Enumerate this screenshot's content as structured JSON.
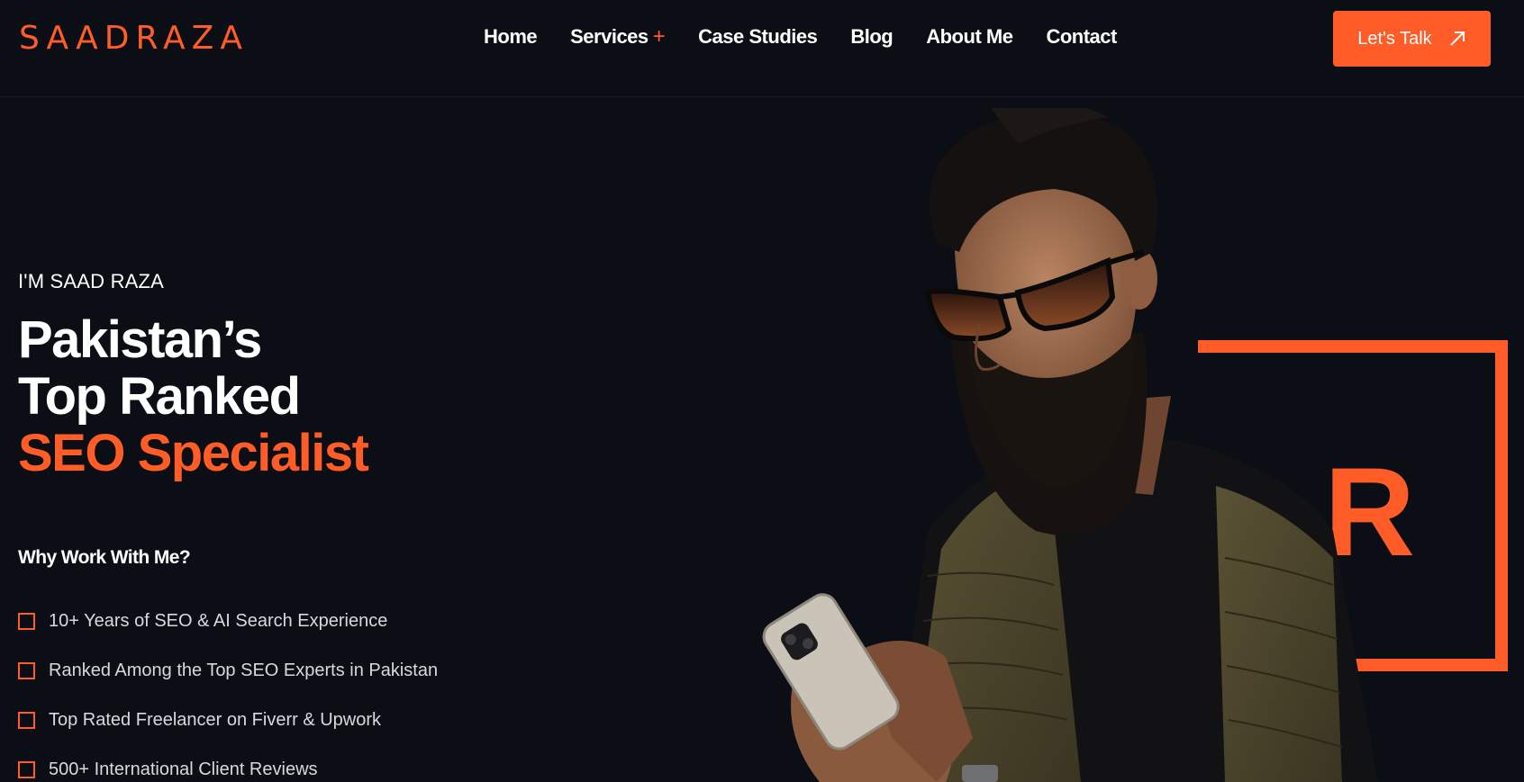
{
  "brand": {
    "logo_text": "SAADRAZA",
    "accent_color": "#ff5c27",
    "bg_color": "#0b0e15"
  },
  "nav": {
    "items": [
      {
        "label": "Home"
      },
      {
        "label": "Services",
        "has_submenu": true,
        "submenu_icon": "+"
      },
      {
        "label": "Case Studies"
      },
      {
        "label": "Blog"
      },
      {
        "label": "About Me"
      },
      {
        "label": "Contact"
      }
    ]
  },
  "cta": {
    "label": "Let's Talk",
    "icon": "arrow-up-right-icon"
  },
  "hero": {
    "eyebrow": "I'M SAAD RAZA",
    "title_line1": "Pakistan’s",
    "title_line2": "Top Ranked",
    "title_line3": "SEO Specialist",
    "why_heading": "Why Work With Me?",
    "benefits": [
      "10+ Years of SEO & AI Search Experience",
      "Ranked Among the Top SEO Experts in Pakistan",
      "Top Rated Freelancer on Fiverr & Upwork",
      "500+ International Client Reviews"
    ]
  },
  "decor": {
    "letter": "R"
  }
}
